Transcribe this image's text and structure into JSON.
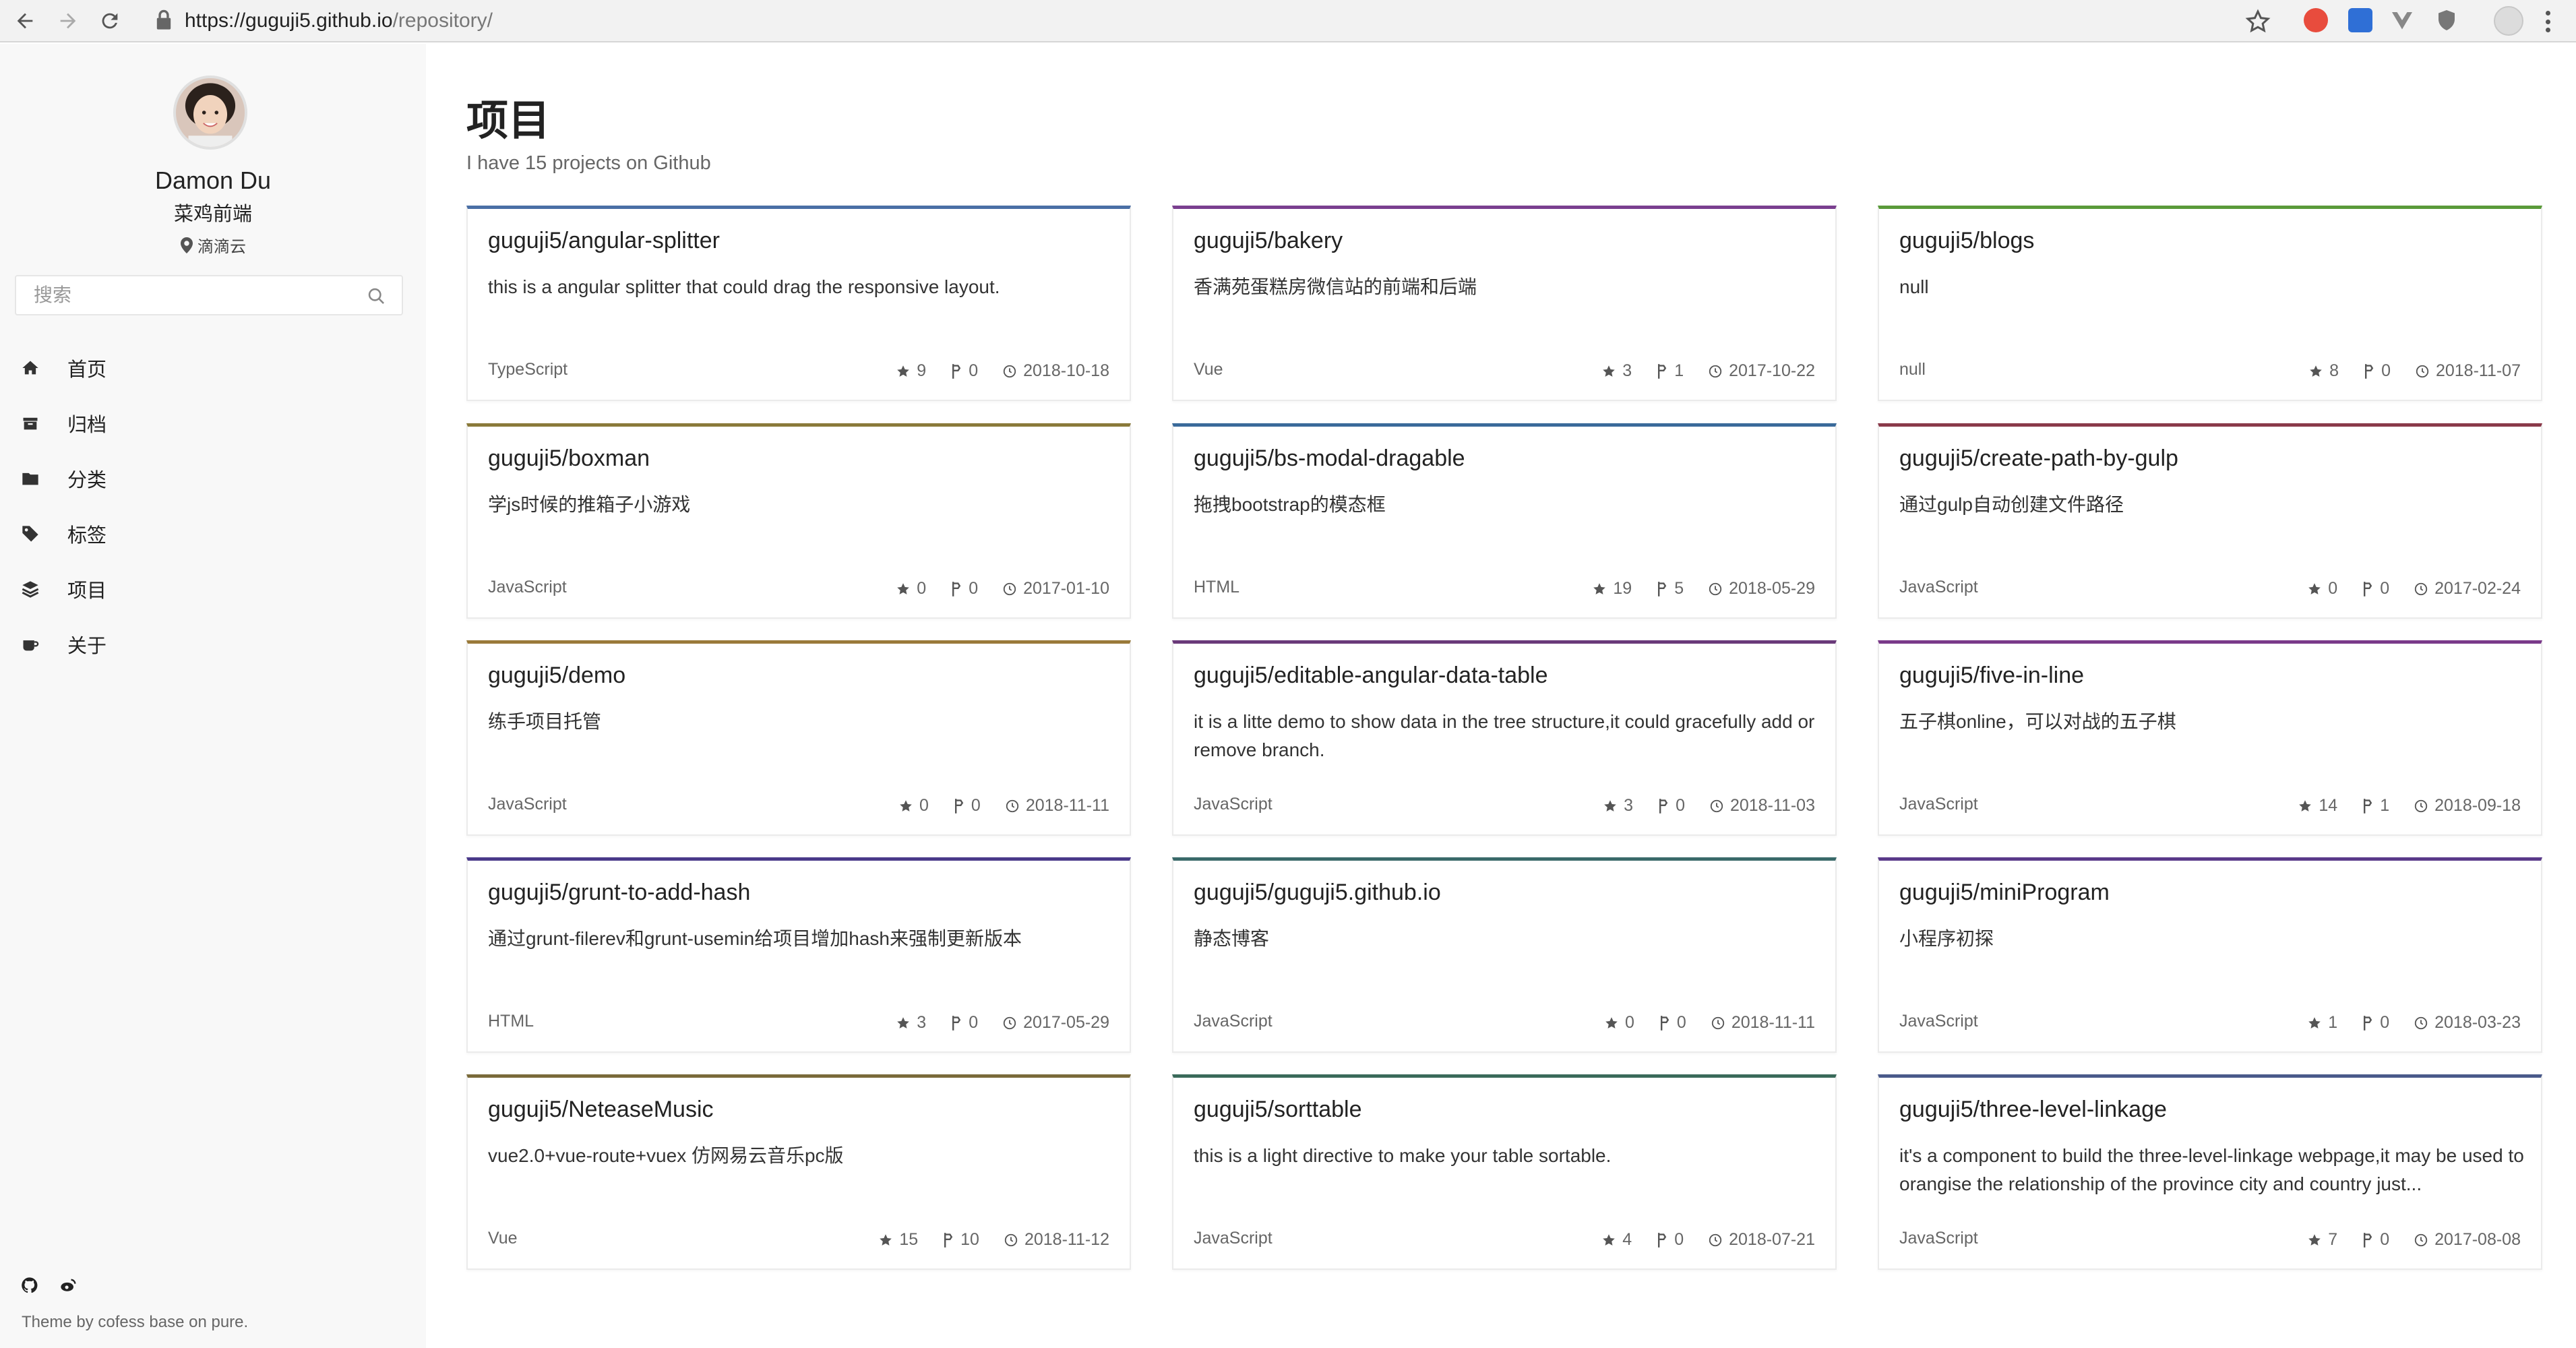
{
  "browser": {
    "url_host": "https://guguji5.github.io",
    "url_path": "/repository/"
  },
  "sidebar": {
    "author_name": "Damon Du",
    "author_title": "菜鸡前端",
    "location": "滴滴云",
    "search_placeholder": "搜索",
    "menu": [
      {
        "label": "首页",
        "icon": "home-icon"
      },
      {
        "label": "归档",
        "icon": "archive-icon"
      },
      {
        "label": "分类",
        "icon": "folder-icon"
      },
      {
        "label": "标签",
        "icon": "tag-icon"
      },
      {
        "label": "项目",
        "icon": "layers-icon"
      },
      {
        "label": "关于",
        "icon": "coffee-icon"
      }
    ],
    "footer_icons": [
      "github-icon",
      "weibo-icon"
    ],
    "theme_note": "Theme by cofess base on pure."
  },
  "main": {
    "title": "项目",
    "subtitle": "I have 15 projects on Github"
  },
  "projects": [
    {
      "name": "guguji5/angular-splitter",
      "desc": "this is a angular splitter that could drag the responsive layout.",
      "lang": "TypeScript",
      "stars": "9",
      "forks": "0",
      "date": "2018-10-18",
      "accent": "#4a6fa5"
    },
    {
      "name": "guguji5/bakery",
      "desc": "香满苑蛋糕房微信站的前端和后端",
      "lang": "Vue",
      "stars": "3",
      "forks": "1",
      "date": "2017-10-22",
      "accent": "#7a3f8f"
    },
    {
      "name": "guguji5/blogs",
      "desc": "null",
      "lang": "null",
      "stars": "8",
      "forks": "0",
      "date": "2018-11-07",
      "accent": "#5a9a3a"
    },
    {
      "name": "guguji5/boxman",
      "desc": "学js时候的推箱子小游戏",
      "lang": "JavaScript",
      "stars": "0",
      "forks": "0",
      "date": "2017-01-10",
      "accent": "#8a7a3a"
    },
    {
      "name": "guguji5/bs-modal-dragable",
      "desc": "拖拽bootstrap的模态框",
      "lang": "HTML",
      "stars": "19",
      "forks": "5",
      "date": "2018-05-29",
      "accent": "#3a6a9a"
    },
    {
      "name": "guguji5/create-path-by-gulp",
      "desc": "通过gulp自动创建文件路径",
      "lang": "JavaScript",
      "stars": "0",
      "forks": "0",
      "date": "2017-02-24",
      "accent": "#8a3a4a"
    },
    {
      "name": "guguji5/demo",
      "desc": "练手项目托管",
      "lang": "JavaScript",
      "stars": "0",
      "forks": "0",
      "date": "2018-11-11",
      "accent": "#9a7a3a"
    },
    {
      "name": "guguji5/editable-angular-data-table",
      "desc": "it is a litte demo to show data in the tree structure,it could gracefully add or remove branch.",
      "lang": "JavaScript",
      "stars": "3",
      "forks": "0",
      "date": "2018-11-03",
      "accent": "#6a3a7a"
    },
    {
      "name": "guguji5/five-in-line",
      "desc": "五子棋online，可以对战的五子棋",
      "lang": "JavaScript",
      "stars": "14",
      "forks": "1",
      "date": "2018-09-18",
      "accent": "#7a3a8a"
    },
    {
      "name": "guguji5/grunt-to-add-hash",
      "desc": "通过grunt-filerev和grunt-usemin给项目增加hash来强制更新版本",
      "lang": "HTML",
      "stars": "3",
      "forks": "0",
      "date": "2017-05-29",
      "accent": "#4a3a8a"
    },
    {
      "name": "guguji5/guguji5.github.io",
      "desc": "静态博客",
      "lang": "JavaScript",
      "stars": "0",
      "forks": "0",
      "date": "2018-11-11",
      "accent": "#3a6a6a"
    },
    {
      "name": "guguji5/miniProgram",
      "desc": "小程序初探",
      "lang": "JavaScript",
      "stars": "1",
      "forks": "0",
      "date": "2018-03-23",
      "accent": "#5a3a8a"
    },
    {
      "name": "guguji5/NeteaseMusic",
      "desc": "vue2.0+vue-route+vuex 仿网易云音乐pc版",
      "lang": "Vue",
      "stars": "15",
      "forks": "10",
      "date": "2018-11-12",
      "accent": "#7a6a3a"
    },
    {
      "name": "guguji5/sorttable",
      "desc": "this is a light directive to make your table sortable.",
      "lang": "JavaScript",
      "stars": "4",
      "forks": "0",
      "date": "2018-07-21",
      "accent": "#3a6a5a"
    },
    {
      "name": "guguji5/three-level-linkage",
      "desc": "it's a component to build the three-level-linkage webpage,it may be used to orangise the relationship of the province city and country just...",
      "lang": "JavaScript",
      "stars": "7",
      "forks": "0",
      "date": "2017-08-08",
      "accent": "#4a5a8a"
    }
  ]
}
